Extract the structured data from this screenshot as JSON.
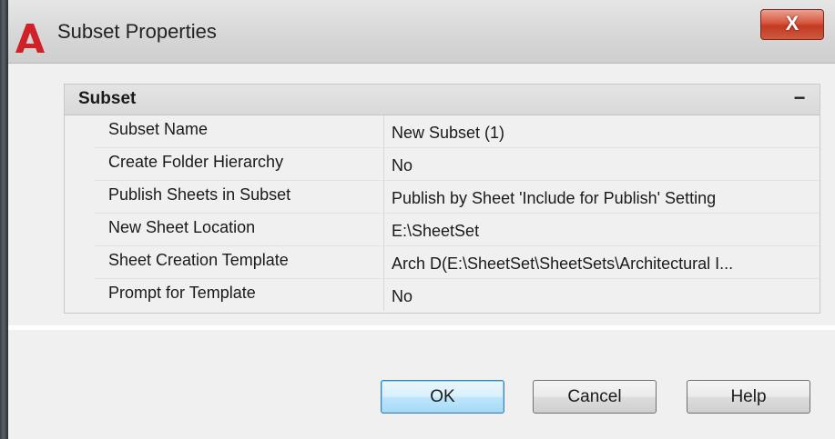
{
  "window": {
    "title": "Subset Properties",
    "close_glyph": "X",
    "logo_letter": "A"
  },
  "grid": {
    "section_title": "Subset",
    "collapse_glyph": "−",
    "rows": [
      {
        "label": "Subset Name",
        "value": "New Subset (1)"
      },
      {
        "label": "Create Folder Hierarchy",
        "value": "No"
      },
      {
        "label": "Publish Sheets in Subset",
        "value": "Publish by Sheet 'Include for Publish' Setting"
      },
      {
        "label": "New Sheet Location",
        "value": "E:\\SheetSet"
      },
      {
        "label": "Sheet Creation Template",
        "value": "Arch D(E:\\SheetSet\\SheetSets\\Architectural I..."
      },
      {
        "label": "Prompt for Template",
        "value": "No"
      }
    ]
  },
  "buttons": {
    "ok": "OK",
    "cancel": "Cancel",
    "help": "Help"
  },
  "colors": {
    "logo_red": "#d0202a",
    "close_red": "#c8442b",
    "default_button_border": "#3c7fb1"
  }
}
